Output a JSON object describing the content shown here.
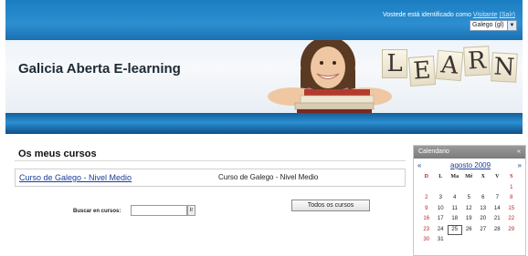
{
  "header": {
    "login_text": "Vostede está identificado como",
    "user_link": "Visitante",
    "logout_link": "(Saír)",
    "language_select": "Galego (gl)",
    "site_title": "Galicia Aberta E-learning",
    "banner_word": [
      "L",
      "E",
      "A",
      "R",
      "N"
    ]
  },
  "courses": {
    "title": "Os meus cursos",
    "items": [
      {
        "link": "Curso de Galego - Nivel Medio",
        "summary": "Curso de Galego - Nivel Medio"
      }
    ],
    "search_label": "Buscar en cursos:",
    "search_value": "",
    "search_button": "Ir",
    "all_courses_button": "Todos os cursos"
  },
  "calendar": {
    "title": "Calendario",
    "hide": "«",
    "prev": "«",
    "month": "agosto 2009",
    "next": "»",
    "weekday_headers": [
      "D",
      "L",
      "Ma",
      "Mé",
      "X",
      "V",
      "S"
    ],
    "today": "25",
    "rows": [
      [
        "",
        "",
        "",
        "",
        "",
        "",
        "1"
      ],
      [
        "2",
        "3",
        "4",
        "5",
        "6",
        "7",
        "8"
      ],
      [
        "9",
        "10",
        "11",
        "12",
        "13",
        "14",
        "15"
      ],
      [
        "16",
        "17",
        "18",
        "19",
        "20",
        "21",
        "22"
      ],
      [
        "23",
        "24",
        "25",
        "26",
        "27",
        "28",
        "29"
      ],
      [
        "30",
        "31",
        "",
        "",
        "",
        "",
        ""
      ]
    ]
  },
  "colors": {
    "header_blue": "#1b7ec2",
    "link_blue": "#1a3d9a",
    "weekend_red": "#c12020"
  }
}
